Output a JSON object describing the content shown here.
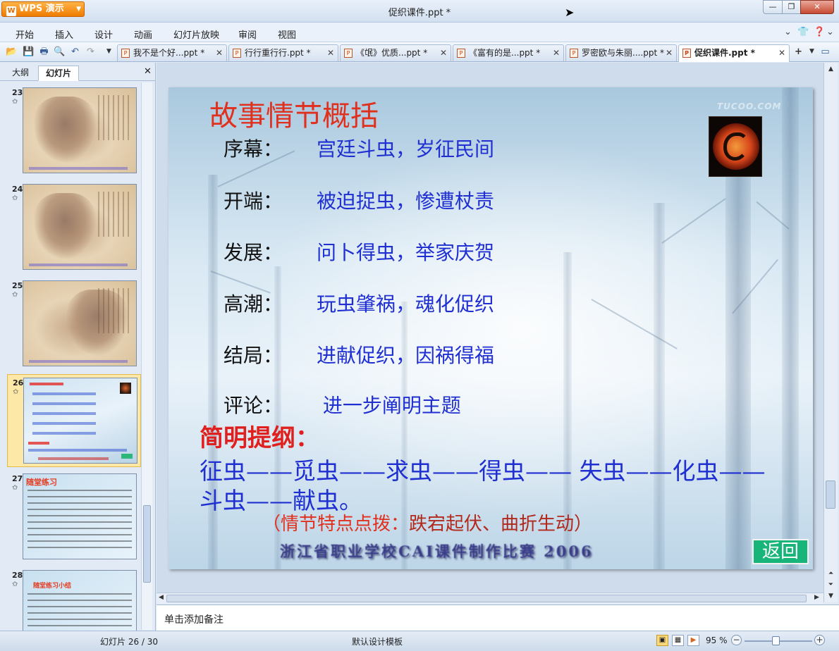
{
  "app": {
    "menu_button": "WPS 演示",
    "window_title": "促织课件.ppt *",
    "close_symbol": "✕",
    "min_symbol": "—",
    "max_symbol": "❐"
  },
  "menu": [
    "开始",
    "插入",
    "设计",
    "动画",
    "幻灯片放映",
    "审阅",
    "视图"
  ],
  "tabs": [
    {
      "label": "我不是个好...ppt *",
      "active": false
    },
    {
      "label": "行行重行行.ppt *",
      "active": false
    },
    {
      "label": "《氓》优质...ppt *",
      "active": false
    },
    {
      "label": "《富有的是...ppt *",
      "active": false
    },
    {
      "label": "罗密欧与朱丽....ppt *",
      "active": false
    },
    {
      "label": "促织课件.ppt *",
      "active": true
    }
  ],
  "left_panel": {
    "tab_outline": "大纲",
    "tab_slides": "幻灯片",
    "close": "✕",
    "thumbnails": [
      {
        "number": "23",
        "style": "old",
        "selected": false
      },
      {
        "number": "24",
        "style": "old",
        "selected": false
      },
      {
        "number": "25",
        "style": "old",
        "selected": false
      },
      {
        "number": "26",
        "style": "snow",
        "selected": true
      },
      {
        "number": "27",
        "style": "practice",
        "heading": "随堂练习",
        "selected": false
      },
      {
        "number": "28",
        "style": "practice",
        "heading": "随堂练习小结",
        "selected": false
      }
    ]
  },
  "slide": {
    "title": "故事情节概括",
    "watermark": "TUCOO.COM",
    "outline": [
      {
        "label": "序幕：",
        "value": "宫廷斗虫，岁征民间"
      },
      {
        "label": "开端：",
        "value": "被迫捉虫，惨遭杖责"
      },
      {
        "label": "发展：",
        "value": "问卜得虫，举家庆贺"
      },
      {
        "label": "高潮：",
        "value": "玩虫肇祸，魂化促织"
      },
      {
        "label": "结局：",
        "value": "进献促织，因祸得福"
      },
      {
        "label": "评论：",
        "value": " 进一步阐明主题"
      }
    ],
    "summary_title": "简明提纲：",
    "summary_line1": "征虫——觅虫——求虫——得虫—— 失虫——化虫——",
    "summary_line2": "斗虫——献虫。",
    "tip_prefix": "（情节特点点拨：",
    "tip_value": "跌宕起伏、曲折生动",
    "tip_suffix": "）",
    "footer": "浙江省职业学校CAI课件制作比赛  2006",
    "return_button": "返回"
  },
  "notes_placeholder": "单击添加备注",
  "status": {
    "slide_counter": "幻灯片 26 / 30",
    "template": "默认设计模板",
    "zoom": "95 %"
  }
}
